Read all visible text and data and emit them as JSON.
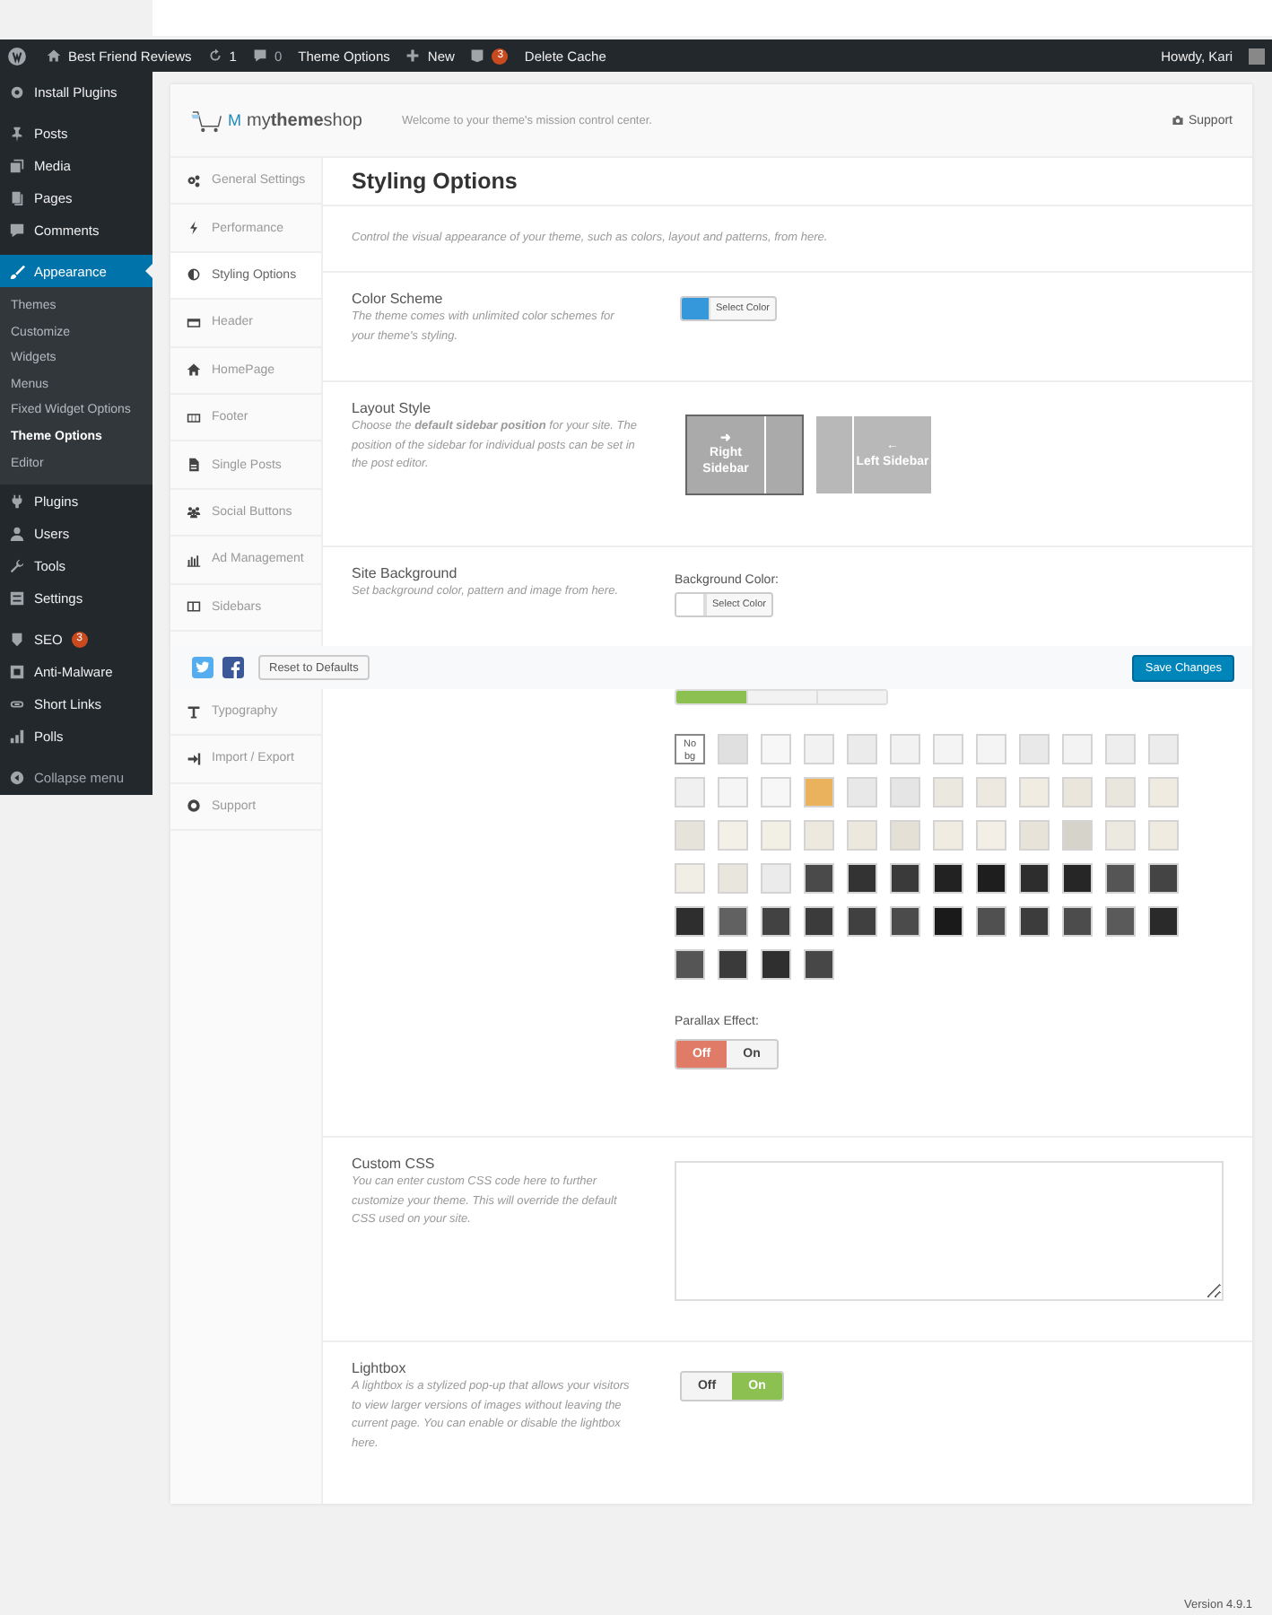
{
  "admin_bar": {
    "site": "Best Friend Reviews",
    "updates": "1",
    "comments": "0",
    "theme_options": "Theme Options",
    "new": "New",
    "seo_badge": "3",
    "delete_cache": "Delete Cache",
    "howdy": "Howdy, Kari"
  },
  "sidebar": {
    "sections": [
      [
        {
          "label": "Install Plugins",
          "selected": false
        }
      ],
      [
        {
          "label": "Posts",
          "selected": false
        },
        {
          "label": "Media",
          "selected": false
        },
        {
          "label": "Pages",
          "selected": false
        },
        {
          "label": "Comments",
          "selected": false
        }
      ],
      [
        {
          "label": "Appearance",
          "selected": true,
          "children": [
            {
              "label": "Themes",
              "selected": false
            },
            {
              "label": "Customize",
              "selected": false
            },
            {
              "label": "Widgets",
              "selected": false
            },
            {
              "label": "Menus",
              "selected": false
            },
            {
              "label": "Fixed Widget Options",
              "selected": false
            },
            {
              "label": "Theme Options",
              "selected": true
            },
            {
              "label": "Editor",
              "selected": false
            }
          ]
        },
        {
          "label": "Plugins",
          "selected": false
        },
        {
          "label": "Users",
          "selected": false
        },
        {
          "label": "Tools",
          "selected": false
        },
        {
          "label": "Settings",
          "selected": false
        }
      ],
      [
        {
          "label": "SEO",
          "selected": false,
          "badge": "3"
        },
        {
          "label": "Anti-Malware",
          "selected": false
        },
        {
          "label": "Short Links",
          "selected": false
        },
        {
          "label": "Polls",
          "selected": false
        }
      ]
    ],
    "collapse": "Collapse menu"
  },
  "header": {
    "logo_mark": "M",
    "logo_prefix": "my",
    "logo_bold": "theme",
    "logo_suffix": "shop",
    "welcome": "Welcome to your theme's mission control center.",
    "support": "Support"
  },
  "nav": {
    "items": [
      {
        "label": "General Settings",
        "selected": false
      },
      {
        "label": "Performance",
        "selected": false
      },
      {
        "label": "Styling Options",
        "selected": true
      },
      {
        "label": "Header",
        "selected": false
      },
      {
        "label": "HomePage",
        "selected": false
      },
      {
        "label": "Footer",
        "selected": false
      },
      {
        "label": "Single Posts",
        "selected": false
      },
      {
        "label": "Social Buttons",
        "selected": false
      },
      {
        "label": "Ad Management",
        "selected": false
      },
      {
        "label": "Sidebars",
        "selected": false
      }
    ],
    "items_after": [
      {
        "label": "Typography",
        "selected": false
      },
      {
        "label": "Import / Export",
        "selected": false
      },
      {
        "label": "Support",
        "selected": false
      }
    ]
  },
  "page": {
    "title": "Styling Options",
    "description": "Control the visual appearance of your theme, such as colors, layout and patterns, from here."
  },
  "color_scheme": {
    "label": "Color Scheme",
    "description": "The theme comes with unlimited color schemes for your theme's styling.",
    "color": "#3498db",
    "button": "Select Color"
  },
  "layout_style": {
    "label": "Layout Style",
    "description": "Choose the **default sidebar position** for your site. The position of the sidebar for individual posts can be set in the post editor.",
    "options": [
      {
        "arrow": "➜",
        "label": "Right Sidebar",
        "selected": true
      },
      {
        "arrow": "←",
        "label": "Left Sidebar",
        "selected": false
      }
    ]
  },
  "site_background": {
    "label": "Site Background",
    "description": "Set background color, pattern and image from here.",
    "color_label": "Background Color:",
    "color": "#ffffff",
    "button": "Select Color",
    "tabs": [
      {
        "selected": true
      },
      {
        "selected": false
      },
      {
        "selected": false
      }
    ],
    "patterns": [
      {
        "kind": "none",
        "label": "No bg"
      },
      {
        "kind": "swatch",
        "color": "#e0e0e0"
      },
      {
        "kind": "swatch",
        "color": "#f7f7f7"
      },
      {
        "kind": "swatch",
        "color": "#f2f2f2"
      },
      {
        "kind": "swatch",
        "color": "#ebebeb"
      },
      {
        "kind": "swatch",
        "color": "#f2f2f2"
      },
      {
        "kind": "swatch",
        "color": "#f4f4f4"
      },
      {
        "kind": "swatch",
        "color": "#f4f4f4"
      },
      {
        "kind": "swatch",
        "color": "#e9e9e9"
      },
      {
        "kind": "swatch",
        "color": "#f3f3f3"
      },
      {
        "kind": "swatch",
        "color": "#eeeeee"
      },
      {
        "kind": "swatch",
        "color": "#ececec"
      },
      {
        "kind": "swatch",
        "color": "#f0f0f0"
      },
      {
        "kind": "swatch",
        "color": "#f5f5f5"
      },
      {
        "kind": "swatch",
        "color": "#f7f7f7"
      },
      {
        "kind": "swatch",
        "color": "#eab25c"
      },
      {
        "kind": "swatch",
        "color": "#e8e8e8"
      },
      {
        "kind": "swatch",
        "color": "#e5e5e5"
      },
      {
        "kind": "swatch",
        "color": "#ebe8df"
      },
      {
        "kind": "swatch",
        "color": "#ede9e0"
      },
      {
        "kind": "swatch",
        "color": "#f0ece2"
      },
      {
        "kind": "swatch",
        "color": "#ebe6dc"
      },
      {
        "kind": "swatch",
        "color": "#e9e6de"
      },
      {
        "kind": "swatch",
        "color": "#efebe0"
      },
      {
        "kind": "swatch",
        "color": "#e6e3da"
      },
      {
        "kind": "swatch",
        "color": "#f3f0e7"
      },
      {
        "kind": "swatch",
        "color": "#f2efe5"
      },
      {
        "kind": "swatch",
        "color": "#ede9df"
      },
      {
        "kind": "swatch",
        "color": "#ece8dd"
      },
      {
        "kind": "swatch",
        "color": "#e4e0d6"
      },
      {
        "kind": "swatch",
        "color": "#f0ece2"
      },
      {
        "kind": "swatch",
        "color": "#f3efe6"
      },
      {
        "kind": "swatch",
        "color": "#e7e3d9"
      },
      {
        "kind": "swatch",
        "color": "#d6d3cb"
      },
      {
        "kind": "swatch",
        "color": "#ece9e1"
      },
      {
        "kind": "swatch",
        "color": "#efebe1"
      },
      {
        "kind": "swatch",
        "color": "#f1eee6"
      },
      {
        "kind": "swatch",
        "color": "#e9e6dd"
      },
      {
        "kind": "swatch",
        "color": "#ebebeb"
      },
      {
        "kind": "swatch",
        "color": "#4a4a4a"
      },
      {
        "kind": "swatch",
        "color": "#333333"
      },
      {
        "kind": "swatch",
        "color": "#3a3a3a"
      },
      {
        "kind": "swatch",
        "color": "#222222"
      },
      {
        "kind": "swatch",
        "color": "#1e1e1e"
      },
      {
        "kind": "swatch",
        "color": "#2d2d2d"
      },
      {
        "kind": "swatch",
        "color": "#262626"
      },
      {
        "kind": "swatch",
        "color": "#555555"
      },
      {
        "kind": "swatch",
        "color": "#444444"
      },
      {
        "kind": "swatch",
        "color": "#2e2e2e"
      },
      {
        "kind": "swatch",
        "color": "#616161"
      },
      {
        "kind": "swatch",
        "color": "#424242"
      },
      {
        "kind": "swatch",
        "color": "#3b3b3b"
      },
      {
        "kind": "swatch",
        "color": "#404040"
      },
      {
        "kind": "swatch",
        "color": "#4b4b4b"
      },
      {
        "kind": "swatch",
        "color": "#1a1a1a"
      },
      {
        "kind": "swatch",
        "color": "#505050"
      },
      {
        "kind": "swatch",
        "color": "#3c3c3c"
      },
      {
        "kind": "swatch",
        "color": "#4c4c4c"
      },
      {
        "kind": "swatch",
        "color": "#5a5a5a"
      },
      {
        "kind": "swatch",
        "color": "#2a2a2a"
      },
      {
        "kind": "swatch",
        "color": "#555555"
      },
      {
        "kind": "swatch",
        "color": "#3a3a3a"
      },
      {
        "kind": "swatch",
        "color": "#2f2f2f"
      },
      {
        "kind": "swatch",
        "color": "#474747"
      }
    ],
    "parallax_label": "Parallax Effect:",
    "parallax": [
      {
        "kind": "off",
        "label": "Off",
        "selected": true
      },
      {
        "kind": "on",
        "label": "On",
        "selected": false
      }
    ]
  },
  "custom_css": {
    "label": "Custom CSS",
    "description": "You can enter custom CSS code here to further customize your theme. This will override the default CSS used on your site."
  },
  "lightbox": {
    "label": "Lightbox",
    "description": "A lightbox is a stylized pop-up that allows your visitors to view larger versions of images without leaving the current page. You can enable or disable the lightbox here.",
    "options": [
      {
        "kind": "off",
        "label": "Off",
        "selected": false
      },
      {
        "kind": "on",
        "label": "On",
        "selected": true
      }
    ]
  },
  "action_bar": {
    "reset": "Reset to Defaults",
    "save": "Save Changes"
  },
  "footer": {
    "version": "Version 4.9.1"
  }
}
